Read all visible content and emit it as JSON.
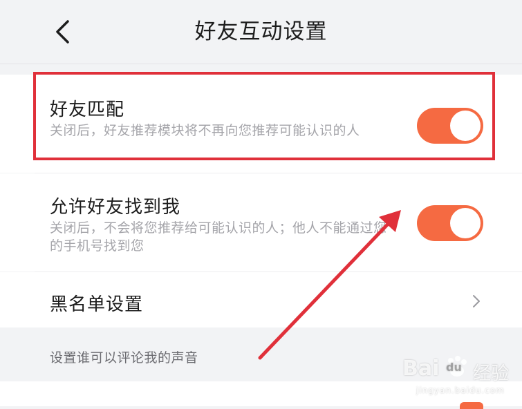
{
  "header": {
    "title": "好友互动设置",
    "back_icon": "chevron-left-icon"
  },
  "settings": [
    {
      "title": "好友匹配",
      "description": "关闭后，好友推荐模块将不再向您推荐可能认识的人",
      "enabled": true
    },
    {
      "title": "允许好友找到我",
      "description": "关闭后，不会将您推荐给可能认识的人；他人不能通过您的手机号找到您",
      "enabled": true
    },
    {
      "title": "黑名单设置",
      "chevron_icon": "chevron-right-icon"
    }
  ],
  "section_label": "设置谁可以评论我的声音",
  "watermark": {
    "brand": "Bai",
    "brand2": "du",
    "suffix": "经验",
    "url": "jingyan.baidu.com"
  },
  "colors": {
    "accent": "#f56a42",
    "highlight": "#e0303a",
    "arrow": "#e0303a",
    "background": "#f2f3f5"
  }
}
